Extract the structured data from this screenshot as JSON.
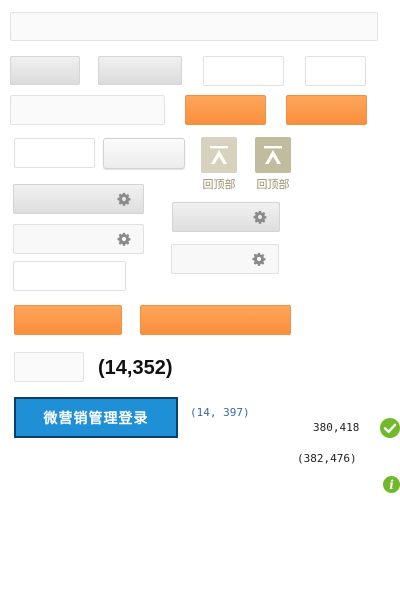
{
  "to_top": {
    "label": "回顶部",
    "colors": {
      "inactive": "#d6d2bd",
      "active": "#c2bc9f"
    }
  },
  "coordinates": {
    "large": "(14,352)",
    "blue": "(14, 397)",
    "plain": "380,418",
    "parenthesized": "(382,476)"
  },
  "login": {
    "label": "微营销管理登录"
  },
  "colors": {
    "accent_orange": "#fa9444",
    "login_blue": "#1f8fd6",
    "success_green": "#71b82a",
    "info_green": "#71b82a"
  },
  "icons": {
    "gear": "gear-icon",
    "arrow_up_to_top": "arrow-to-top-icon",
    "success": "check-circle-icon",
    "info": "info-circle-icon"
  }
}
